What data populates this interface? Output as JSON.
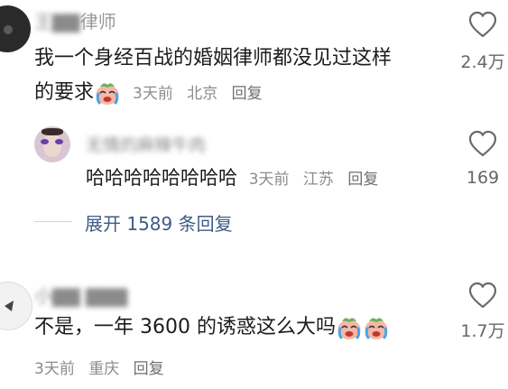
{
  "comments": [
    {
      "username": "王律师律师",
      "username_blurred_part": "王▇▇",
      "username_clear_part": "律师",
      "text_line1": "我一个身经百战的婚姻律师都没见过这样",
      "text_line2": "的要求",
      "time": "3天前",
      "location": "北京",
      "reply_label": "回复",
      "likes": "2.4万"
    },
    {
      "username": "无情的麻辣牛肉",
      "text": "哈哈哈哈哈哈哈哈",
      "time": "3天前",
      "location": "江苏",
      "reply_label": "回复",
      "likes": "169"
    },
    {
      "username": "小▇▇ ▇▇▇",
      "text": "不是，一年 3600 的诱惑这么大吗",
      "time": "3天前",
      "location": "重庆",
      "reply_label": "回复",
      "likes": "1.7万"
    }
  ],
  "expand_replies": "展开 1589 条回复",
  "icons": {
    "like": "heart-outline-icon",
    "emoji": "crying-laughing-emoji"
  },
  "colors": {
    "text": "#1c1c1c",
    "meta": "#8c8c8c",
    "link": "#3f5c86"
  }
}
